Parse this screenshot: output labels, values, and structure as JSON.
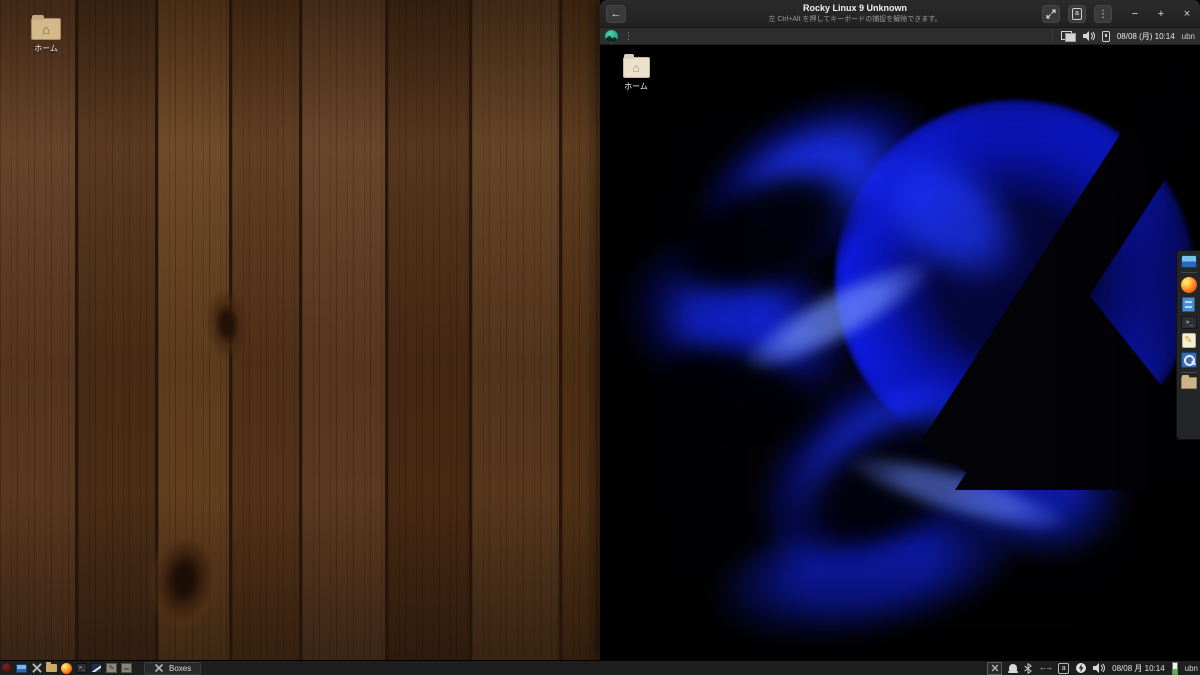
{
  "glyphs": {
    "back": "←",
    "kebab": "⋮",
    "dots": "⋮",
    "house": "⌂",
    "pencil": "✎",
    "prompt": ">_",
    "arrows": "←→"
  },
  "boxes": {
    "title": "Rocky Linux 9 Unknown",
    "subtitle": "左 Ctrl+Alt を押してキーボードの捕捉を解除できます。",
    "keyboard_letter": "a",
    "minimize": "−",
    "maximize": "+",
    "close": "×"
  },
  "vm": {
    "panel": {
      "clock": "08/08 (月) 10:14",
      "user": "ubn"
    },
    "desktop": {
      "home_label": "ホーム"
    },
    "dock_icons": [
      "display",
      "firefox",
      "file-manager",
      "terminal",
      "text-editor",
      "screenshot-search",
      "folder"
    ]
  },
  "host": {
    "desktop": {
      "home_label": "ホーム"
    },
    "taskbar": {
      "icons": [
        "menu",
        "display",
        "window-switcher",
        "file-manager",
        "firefox",
        "terminal",
        "image-viewer",
        "text-editor",
        "package-manager"
      ],
      "task_label": "Boxes",
      "input_letter": "a",
      "clock": "08/08 月 10:14",
      "user": "ubn"
    }
  },
  "colors": {
    "accent_blue": "#0d18c8",
    "rocky_green": "#2eb398",
    "titlebar": "#262626",
    "vm_panel": "#2d2d2d",
    "taskbar": "#1e1e1e",
    "folder_tan": "#d2b98a",
    "wood_brown": "#5d3a21"
  }
}
